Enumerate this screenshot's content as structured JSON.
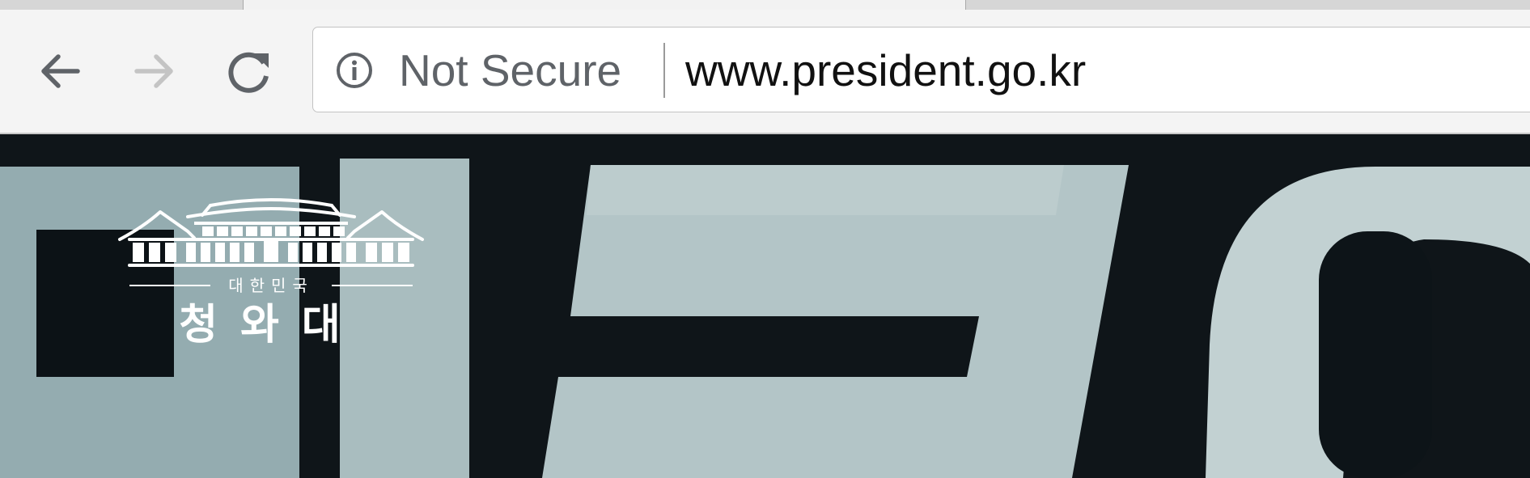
{
  "browser": {
    "security_label": "Not Secure",
    "url": "www.president.go.kr",
    "icons": {
      "back": "arrow-left",
      "forward": "arrow-right",
      "reload": "reload",
      "security": "info-circle"
    },
    "colors": {
      "toolbar": "#f4f4f4",
      "omnibox": "#ffffff",
      "security_text": "#5f6368",
      "url_text": "#111111"
    }
  },
  "page": {
    "logo": {
      "subtitle": "대한민국",
      "title": "청와대"
    },
    "colors": {
      "background_dark": "#0f1519",
      "background_light": "#aebfc1",
      "logo": "#ffffff"
    }
  }
}
